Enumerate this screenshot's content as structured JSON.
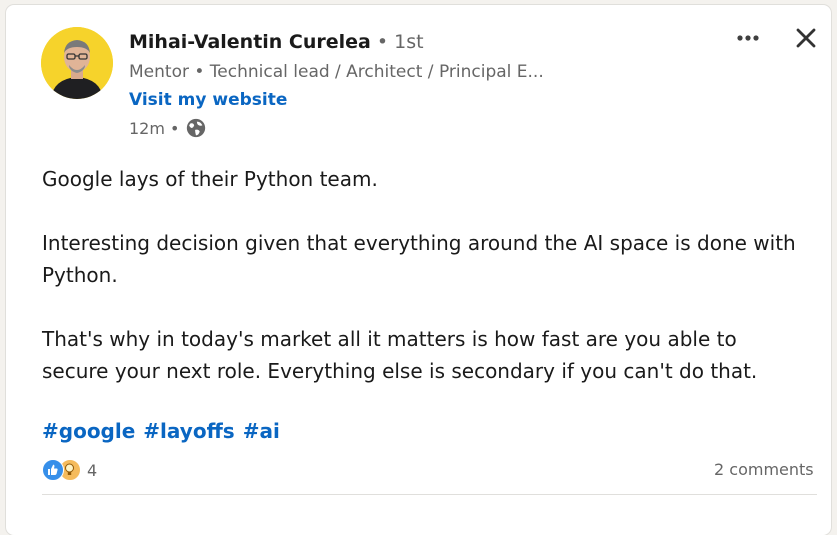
{
  "post": {
    "author": {
      "name": "Mihai-Valentin Curelea",
      "degree": " • 1st",
      "headline": "Mentor • Technical lead / Architect / Principal E...",
      "website_label": "Visit my website"
    },
    "time": "12m •",
    "visibility_icon": "globe-icon",
    "body": {
      "line1": "Google lays of their Python team.",
      "line2": "Interesting decision given that everything around the AI space is done with Python.",
      "line3": "That's why in today's market all it matters is how fast are you able to secure your next role. Everything else is secondary if you can't do that."
    },
    "hashtags": [
      "#google",
      "#layoffs",
      "#ai"
    ],
    "reactions": {
      "icons": [
        "like-icon",
        "insightful-icon"
      ],
      "count": "4"
    },
    "comments_label": "2 comments"
  },
  "colors": {
    "accent": "#0a66c2",
    "avatar_bg": "#f6d32b",
    "muted_text": "#666666",
    "body_text": "#1a1a1a"
  }
}
